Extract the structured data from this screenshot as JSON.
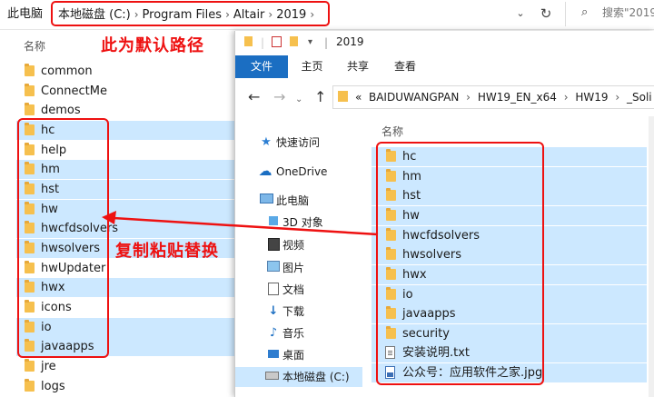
{
  "back_window": {
    "address": {
      "crumbs": [
        "此电脑",
        "本地磁盘 (C:)",
        "Program Files",
        "Altair",
        "2019"
      ],
      "separator": "›",
      "refresh_icon": "refresh-icon",
      "search_placeholder": "搜索\"2019\""
    },
    "column_header": "名称",
    "annotation_top": "此为默认路径",
    "annotation_mid": "复制粘贴替换",
    "annotation_color": "#ee1111",
    "items": [
      {
        "label": "common",
        "selected": false
      },
      {
        "label": "ConnectMe",
        "selected": false
      },
      {
        "label": "demos",
        "selected": false
      },
      {
        "label": "hc",
        "selected": true
      },
      {
        "label": "help",
        "selected": false
      },
      {
        "label": "hm",
        "selected": true
      },
      {
        "label": "hst",
        "selected": true
      },
      {
        "label": "hw",
        "selected": true
      },
      {
        "label": "hwcfdsolvers",
        "selected": true
      },
      {
        "label": "hwsolvers",
        "selected": true
      },
      {
        "label": "hwUpdater",
        "selected": false
      },
      {
        "label": "hwx",
        "selected": true
      },
      {
        "label": "icons",
        "selected": false
      },
      {
        "label": "io",
        "selected": true
      },
      {
        "label": "javaapps",
        "selected": true
      },
      {
        "label": "jre",
        "selected": false
      },
      {
        "label": "logs",
        "selected": false
      }
    ]
  },
  "front_window": {
    "title": "2019",
    "ribbon_tabs": [
      "文件",
      "主页",
      "共享",
      "查看"
    ],
    "path": {
      "prefix": "«",
      "crumbs": [
        "BAIDUWANGPAN",
        "HW19_EN_x64",
        "HW19",
        "_Soli"
      ],
      "separator": "›"
    },
    "nav_pane": [
      {
        "label": "快速访问",
        "icon": "star-icon"
      },
      {
        "label": "OneDrive",
        "icon": "cloud-icon"
      },
      {
        "label": "此电脑",
        "icon": "computer-icon"
      },
      {
        "label": "3D 对象",
        "icon": "cube-icon"
      },
      {
        "label": "视频",
        "icon": "video-icon"
      },
      {
        "label": "图片",
        "icon": "picture-icon"
      },
      {
        "label": "文档",
        "icon": "document-icon"
      },
      {
        "label": "下载",
        "icon": "download-icon"
      },
      {
        "label": "音乐",
        "icon": "music-icon"
      },
      {
        "label": "桌面",
        "icon": "desktop-icon"
      },
      {
        "label": "本地磁盘 (C:)",
        "icon": "drive-icon"
      }
    ],
    "column_header": "名称",
    "items": [
      {
        "label": "hc",
        "kind": "folder"
      },
      {
        "label": "hm",
        "kind": "folder"
      },
      {
        "label": "hst",
        "kind": "folder"
      },
      {
        "label": "hw",
        "kind": "folder"
      },
      {
        "label": "hwcfdsolvers",
        "kind": "folder"
      },
      {
        "label": "hwsolvers",
        "kind": "folder"
      },
      {
        "label": "hwx",
        "kind": "folder"
      },
      {
        "label": "io",
        "kind": "folder"
      },
      {
        "label": "javaapps",
        "kind": "folder"
      },
      {
        "label": "security",
        "kind": "folder"
      },
      {
        "label": "安装说明.txt",
        "kind": "text-file"
      },
      {
        "label": "公众号：应用软件之家.jpg",
        "kind": "image-file"
      }
    ]
  }
}
